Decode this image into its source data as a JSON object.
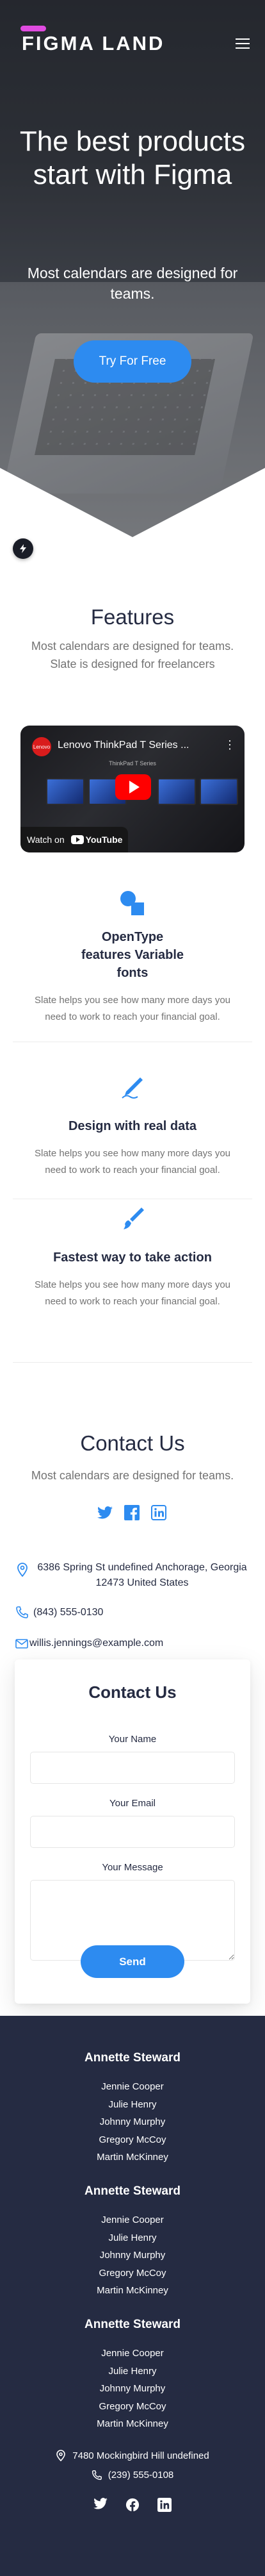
{
  "brand": {
    "name": "FIGMA LAND"
  },
  "hero": {
    "title": "The best products start with Figma",
    "subtitle": "Most calendars are designed for teams.",
    "cta_label": "Try For Free"
  },
  "features": {
    "title": "Features",
    "subtitle": "Most calendars are designed for teams. Slate is designed for freelancers",
    "video": {
      "channel": "Lenovo",
      "title": "Lenovo ThinkPad T Series ...",
      "caption": "ThinkPad T Series",
      "watch_label": "Watch on",
      "platform": "YouTube"
    },
    "items": [
      {
        "icon": "shapes-icon",
        "title": "OpenType features Variable fonts",
        "text": "Slate helps you see how many more days you need to work to reach your financial goal."
      },
      {
        "icon": "pen-icon",
        "title": "Design with real data",
        "text": "Slate helps you see how many more days you need to work to reach your financial goal."
      },
      {
        "icon": "brush-icon",
        "title": "Fastest way to take action",
        "text": "Slate helps you see how many more days you need to work to reach your financial goal."
      }
    ]
  },
  "contact": {
    "title": "Contact Us",
    "subtitle": "Most calendars are designed for teams.",
    "address": "6386 Spring St undefined Anchorage, Georgia 12473 United States",
    "phone": "(843) 555-0130",
    "email": "willis.jennings@example.com",
    "form": {
      "title": "Contact Us",
      "name_label": "Your Name",
      "email_label": "Your Email",
      "message_label": "Your Message",
      "send_label": "Send"
    }
  },
  "footer": {
    "columns": [
      {
        "title": "Annette Steward",
        "links": [
          "Jennie Cooper",
          "Julie Henry",
          "Johnny Murphy",
          "Gregory McCoy",
          "Martin McKinney"
        ]
      },
      {
        "title": "Annette Steward",
        "links": [
          "Jennie Cooper",
          "Julie Henry",
          "Johnny Murphy",
          "Gregory McCoy",
          "Martin McKinney"
        ]
      },
      {
        "title": "Annette Steward",
        "links": [
          "Jennie Cooper",
          "Julie Henry",
          "Johnny Murphy",
          "Gregory McCoy",
          "Martin McKinney"
        ]
      }
    ],
    "address": "7480 Mockingbird Hill undefined",
    "phone": "(239) 555-0108"
  },
  "colors": {
    "primary": "#2D8BF0",
    "dark": "#252B42",
    "muted": "#737373",
    "logo_accent": "#E04BE0"
  }
}
